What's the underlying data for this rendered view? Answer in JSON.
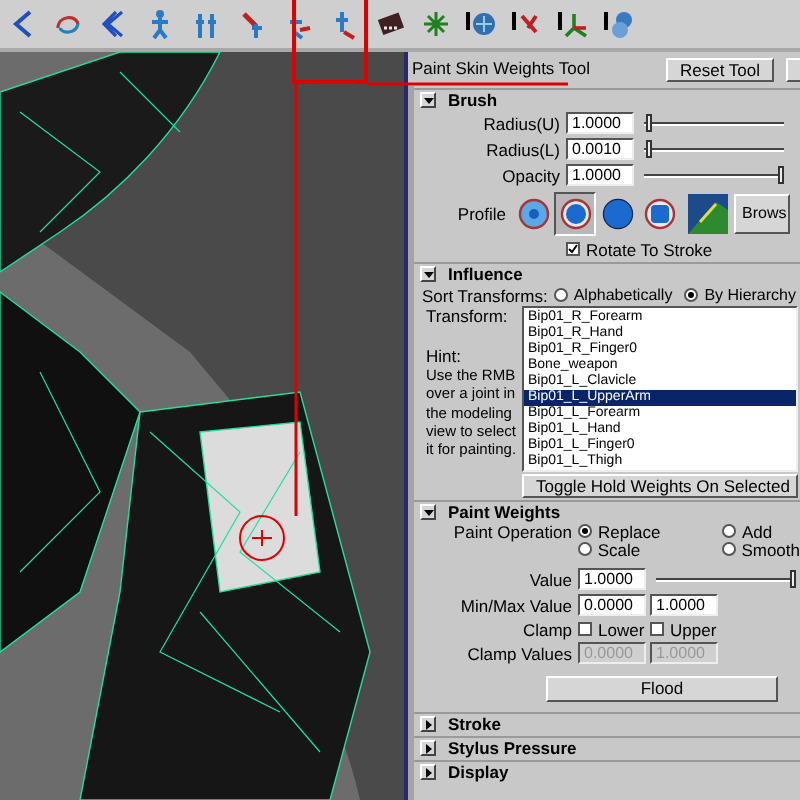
{
  "panel": {
    "title": "Paint Skin Weights Tool",
    "reset_button": "Reset Tool"
  },
  "sections": [
    {
      "kind": "brush",
      "title": "Brush",
      "expanded": true,
      "fields": [
        {
          "label": "Radius(U)",
          "value": "1.0000",
          "level": 0.02
        },
        {
          "label": "Radius(L)",
          "value": "0.0010",
          "level": 0.02
        },
        {
          "label": "Opacity",
          "value": "1.0000",
          "level": 1
        }
      ],
      "profile_label": "Profile",
      "profiles": [
        {
          "kind": "soft",
          "selected": false
        },
        {
          "kind": "hard",
          "selected": true
        },
        {
          "kind": "solid",
          "selected": false
        },
        {
          "kind": "square",
          "selected": false
        }
      ],
      "browse_button": "Brows",
      "rotate": {
        "label": "Rotate To Stroke",
        "checked": true
      }
    },
    {
      "kind": "influence",
      "title": "Influence",
      "expanded": true,
      "sort_label": "Sort Transforms:",
      "sort_options": [
        {
          "label": "Alphabetically",
          "selected": false
        },
        {
          "label": "By Hierarchy",
          "selected": true
        }
      ],
      "transform_label": "Transform:",
      "hint_label": "Hint:",
      "hint": "Use the RMB over a joint in the modeling view to select it for painting.",
      "transforms": [
        {
          "label": "Bip01_R_Forearm",
          "selected": false
        },
        {
          "label": "Bip01_R_Hand",
          "selected": false
        },
        {
          "label": "Bip01_R_Finger0",
          "selected": false
        },
        {
          "label": "Bone_weapon",
          "selected": false
        },
        {
          "label": "Bip01_L_Clavicle",
          "selected": false
        },
        {
          "label": "Bip01_L_UpperArm",
          "selected": true
        },
        {
          "label": "Bip01_L_Forearm",
          "selected": false
        },
        {
          "label": "Bip01_L_Hand",
          "selected": false
        },
        {
          "label": "Bip01_L_Finger0",
          "selected": false
        },
        {
          "label": "Bip01_L_Thigh",
          "selected": false
        }
      ],
      "toggle_button": "Toggle Hold Weights On Selected"
    },
    {
      "kind": "paint_weights",
      "title": "Paint Weights",
      "expanded": true,
      "operation_label": "Paint Operation",
      "operations": [
        {
          "label": "Replace",
          "selected": true
        },
        {
          "label": "Add",
          "selected": false
        },
        {
          "label": "Scale",
          "selected": false
        },
        {
          "label": "Smooth",
          "selected": false
        }
      ],
      "value": {
        "label": "Value",
        "value": "1.0000",
        "level": 1
      },
      "minmax": {
        "label": "Min/Max Value",
        "min": "0.0000",
        "max": "1.0000"
      },
      "clamp": {
        "label": "Clamp",
        "options": [
          {
            "label": "Lower",
            "checked": false
          },
          {
            "label": "Upper",
            "checked": false
          }
        ]
      },
      "clamp_values": {
        "label": "Clamp Values",
        "min": "0.0000",
        "max": "1.0000",
        "disabled": true
      },
      "flood_button": "Flood"
    },
    {
      "kind": "collapsed",
      "title": "Stroke",
      "expanded": false
    },
    {
      "kind": "collapsed",
      "title": "Stylus Pressure",
      "expanded": false
    },
    {
      "kind": "collapsed",
      "title": "Display",
      "expanded": false
    }
  ]
}
